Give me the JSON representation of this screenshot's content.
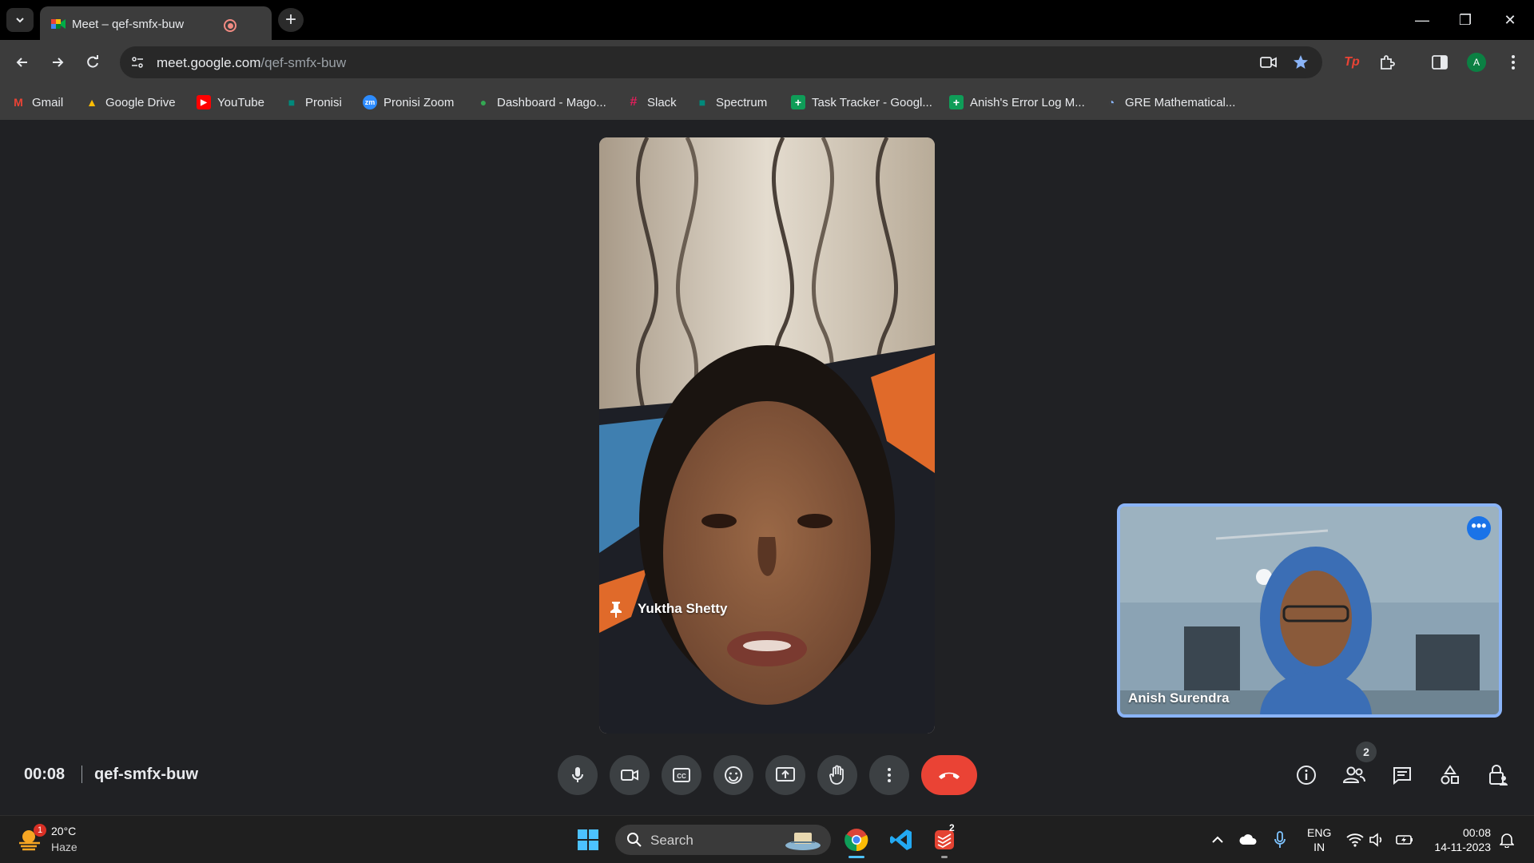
{
  "browser": {
    "tab_title": "Meet – qef-smfx-buw",
    "tab_close": "✕",
    "new_tab": "+",
    "url_host": "meet.google.com",
    "url_path": "/qef-smfx-buw",
    "profile_initial": "A",
    "ext_tp": "Tp",
    "window": {
      "minimize": "—",
      "restore": "❐",
      "close": "✕"
    }
  },
  "bookmarks": [
    {
      "label": "Gmail",
      "icon": "gmail-icon",
      "color": "#ea4335",
      "glyph": "M"
    },
    {
      "label": "Google Drive",
      "icon": "drive-icon",
      "color": "#fbbc04",
      "glyph": "▲"
    },
    {
      "label": "YouTube",
      "icon": "youtube-icon",
      "color": "#ff0000",
      "glyph": "▶"
    },
    {
      "label": "Pronisi",
      "icon": "meet-icon",
      "color": "#00897b",
      "glyph": "■"
    },
    {
      "label": "Pronisi Zoom",
      "icon": "zoom-icon",
      "color": "#2d8cff",
      "glyph": "zm"
    },
    {
      "label": "Dashboard - Mago...",
      "icon": "dashboard-icon",
      "color": "#34a853",
      "glyph": "●"
    },
    {
      "label": "Slack",
      "icon": "slack-icon",
      "color": "#611f69",
      "glyph": "#"
    },
    {
      "label": "Spectrum",
      "icon": "meet-icon",
      "color": "#00897b",
      "glyph": "■"
    },
    {
      "label": "Task Tracker - Googl...",
      "icon": "sheets-icon",
      "color": "#0f9d58",
      "glyph": "+"
    },
    {
      "label": "Anish's Error Log M...",
      "icon": "sheets-icon",
      "color": "#0f9d58",
      "glyph": "+"
    },
    {
      "label": "GRE Mathematical...",
      "icon": "loading-icon",
      "color": "#3c3c3c",
      "glyph": "◔"
    }
  ],
  "meet": {
    "main_participant": "Yuktha Shetty",
    "self_participant": "Anish Surendra",
    "time": "00:08",
    "meeting_code": "qef-smfx-buw",
    "people_count": "2",
    "more_label": "•••"
  },
  "taskbar": {
    "weather_temp": "20°C",
    "weather_desc": "Haze",
    "weather_badge": "1",
    "search_label": "Search",
    "lang_line1": "ENG",
    "lang_line2": "IN",
    "time": "00:08",
    "date": "14-11-2023",
    "todoist_badge": "2"
  },
  "colors": {
    "end_call": "#ea4335",
    "accent": "#8ab4f8",
    "chip_bg": "#3c4043"
  }
}
